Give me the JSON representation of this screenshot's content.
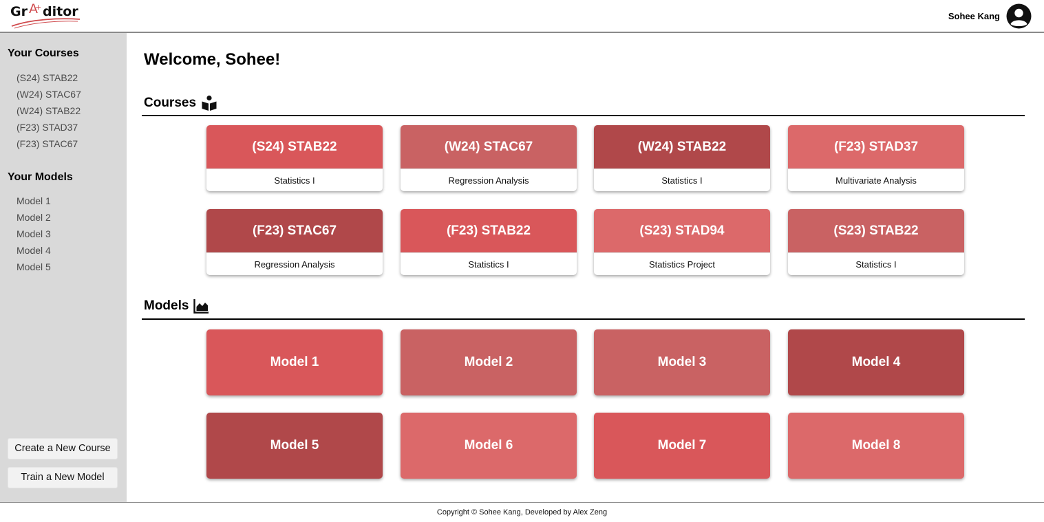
{
  "header": {
    "logo_text": "Gr A ditor",
    "user_name": "Sohee Kang"
  },
  "sidebar": {
    "courses_heading": "Your Courses",
    "courses": [
      "(S24) STAB22",
      "(W24) STAC67",
      "(W24) STAB22",
      "(F23) STAD37",
      "(F23) STAC67"
    ],
    "models_heading": "Your Models",
    "models": [
      "Model 1",
      "Model 2",
      "Model 3",
      "Model 4",
      "Model 5"
    ],
    "create_course_label": "Create a New Course",
    "train_model_label": "Train a New Model"
  },
  "main": {
    "welcome": "Welcome, Sohee!",
    "courses_title": "Courses",
    "models_title": "Models",
    "course_cards": [
      {
        "code": "(S24) STAB22",
        "name": "Statistics I",
        "color": "#d9575a"
      },
      {
        "code": "(W24) STAC67",
        "name": "Regression Analysis",
        "color": "#c96263"
      },
      {
        "code": "(W24) STAB22",
        "name": "Statistics I",
        "color": "#b0484a"
      },
      {
        "code": "(F23) STAD37",
        "name": "Multivariate Analysis",
        "color": "#dc696a"
      },
      {
        "code": "(F23) STAC67",
        "name": "Regression Analysis",
        "color": "#b0484a"
      },
      {
        "code": "(F23) STAB22",
        "name": "Statistics I",
        "color": "#d9575a"
      },
      {
        "code": "(S23) STAD94",
        "name": "Statistics Project",
        "color": "#dc696a"
      },
      {
        "code": "(S23) STAB22",
        "name": "Statistics I",
        "color": "#c96263"
      }
    ],
    "model_cards": [
      {
        "name": "Model 1",
        "color": "#d9575a"
      },
      {
        "name": "Model 2",
        "color": "#c96263"
      },
      {
        "name": "Model 3",
        "color": "#c96263"
      },
      {
        "name": "Model 4",
        "color": "#b0484a"
      },
      {
        "name": "Model 5",
        "color": "#b0484a"
      },
      {
        "name": "Model 6",
        "color": "#dc696a"
      },
      {
        "name": "Model 7",
        "color": "#d9575a"
      },
      {
        "name": "Model 8",
        "color": "#dc696a"
      }
    ]
  },
  "footer": {
    "copyright": "Copyright © Sohee Kang, Developed by Alex Zeng"
  },
  "icons": {
    "courses": "reading-book-icon",
    "models": "area-chart-icon",
    "user": "user-circle-icon"
  }
}
